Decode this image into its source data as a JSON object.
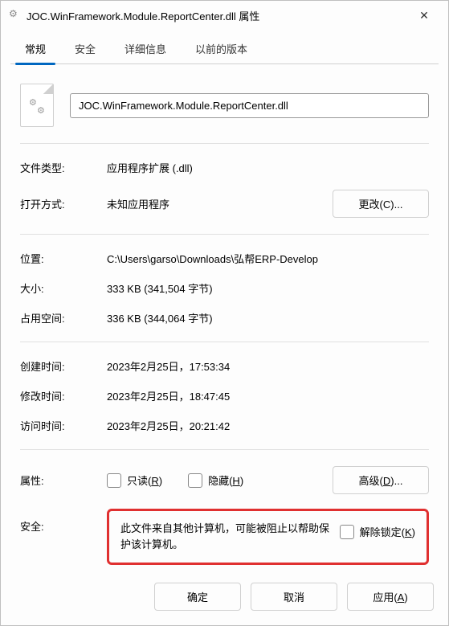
{
  "title": "JOC.WinFramework.Module.ReportCenter.dll 属性",
  "tabs": {
    "general": "常规",
    "security": "安全",
    "details": "详细信息",
    "previous": "以前的版本"
  },
  "filename": "JOC.WinFramework.Module.ReportCenter.dll",
  "labels": {
    "fileType": "文件类型:",
    "opensWith": "打开方式:",
    "location": "位置:",
    "size": "大小:",
    "sizeOnDisk": "占用空间:",
    "created": "创建时间:",
    "modified": "修改时间:",
    "accessed": "访问时间:",
    "attributes": "属性:",
    "securityLabel": "安全:"
  },
  "values": {
    "fileType": "应用程序扩展 (.dll)",
    "opensWith": "未知应用程序",
    "location": "C:\\Users\\garso\\Downloads\\弘帮ERP-Develop",
    "size": "333 KB (341,504 字节)",
    "sizeOnDisk": "336 KB (344,064 字节)",
    "created": "2023年2月25日，17:53:34",
    "modified": "2023年2月25日，18:47:45",
    "accessed": "2023年2月25日，20:21:42"
  },
  "buttons": {
    "change": "更改(C)...",
    "advanced": "高级(D)...",
    "ok": "确定",
    "cancel": "取消",
    "apply": "应用(A)"
  },
  "checkboxes": {
    "readOnly": "只读(R)",
    "hidden": "隐藏(H)",
    "unblock": "解除锁定(K)"
  },
  "securityMessage": "此文件来自其他计算机，可能被阻止以帮助保护该计算机。"
}
